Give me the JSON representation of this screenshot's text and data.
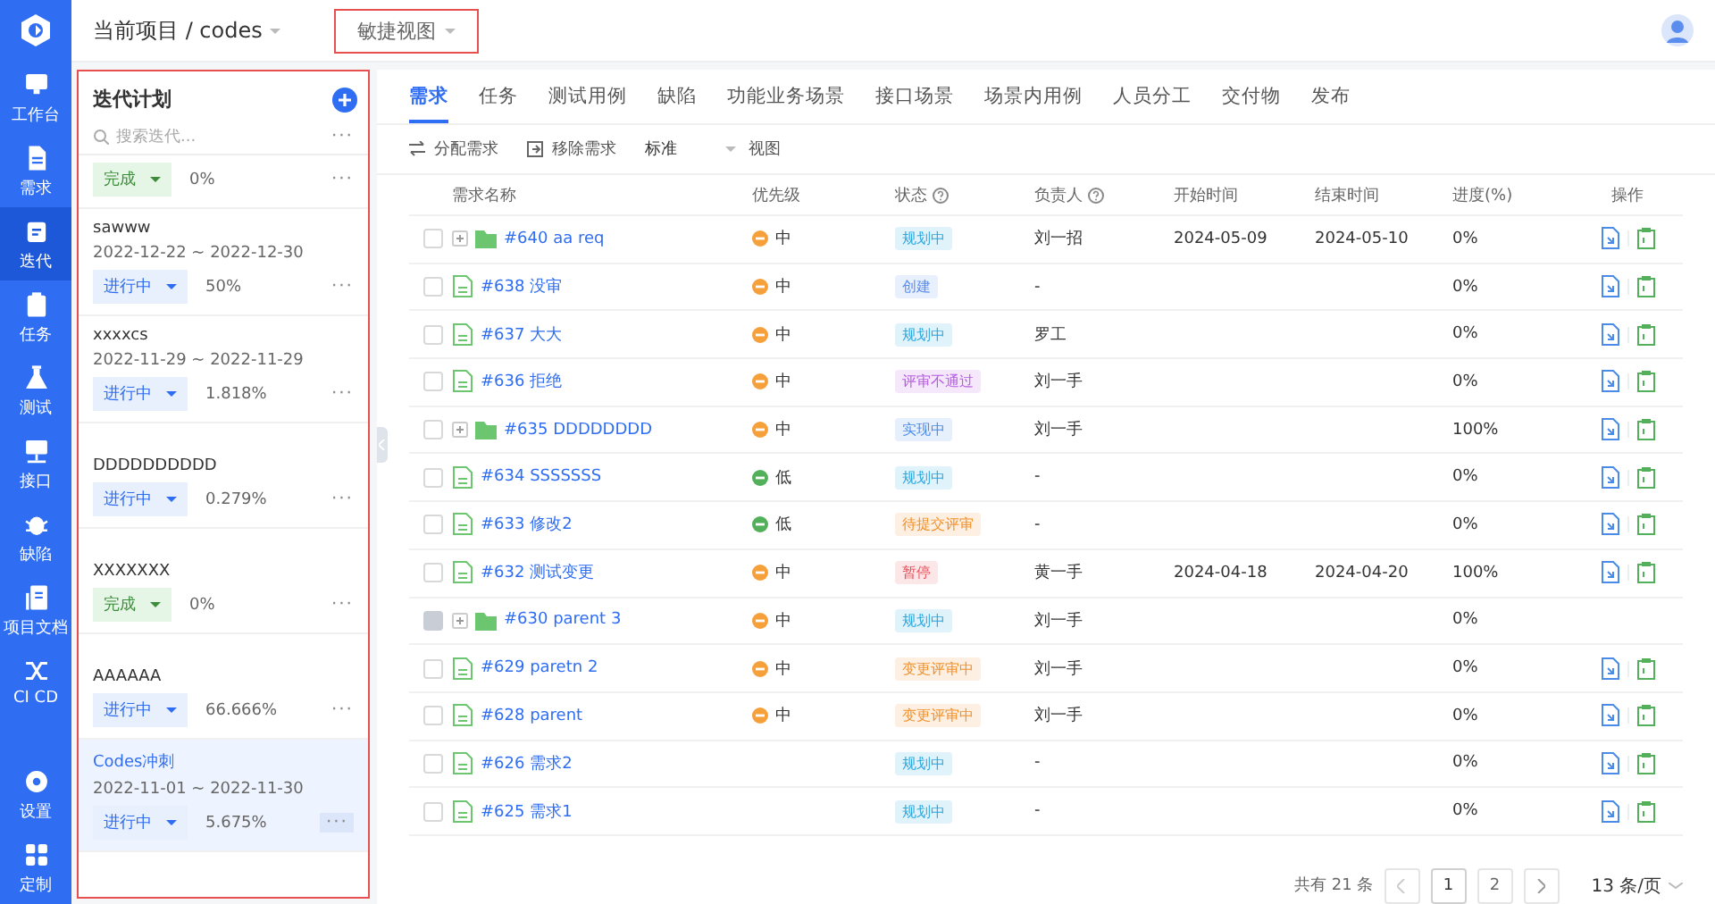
{
  "nav": {
    "items": [
      {
        "label": "工作台",
        "selected": false
      },
      {
        "label": "需求",
        "selected": false
      },
      {
        "label": "迭代",
        "selected": true
      },
      {
        "label": "任务",
        "selected": false
      },
      {
        "label": "测试",
        "selected": false
      },
      {
        "label": "接口",
        "selected": false
      },
      {
        "label": "缺陷",
        "selected": false
      },
      {
        "label": "项目文档",
        "selected": false
      },
      {
        "label": "CI CD",
        "selected": false
      }
    ],
    "bottom_items": [
      {
        "label": "设置",
        "selected": false
      },
      {
        "label": "定制",
        "selected": false
      }
    ]
  },
  "topbar": {
    "project_label": "当前项目 / codes",
    "view_label": "敏捷视图"
  },
  "iteration_panel": {
    "title": "迭代计划",
    "search": {
      "placeholder": "搜索迭代...",
      "more": "···"
    },
    "items": [
      {
        "status": "完成",
        "kind": "done",
        "progress": "0%",
        "more": "···",
        "selected": false
      },
      {
        "name": "sawww",
        "dates": "2022-12-22 ~ 2022-12-30",
        "status": "进行中",
        "kind": "active",
        "progress": "50%",
        "more": "···",
        "selected": false
      },
      {
        "name": "xxxxcs",
        "dates": "2022-11-29 ~ 2022-11-29",
        "status": "进行中",
        "kind": "active",
        "progress": "1.818%",
        "more": "···",
        "selected": false
      },
      {
        "name": "DDDDDDDDDD",
        "status": "进行中",
        "kind": "active",
        "progress": "0.279%",
        "more": "···",
        "selected": false
      },
      {
        "name": "XXXXXXX",
        "status": "完成",
        "kind": "done",
        "progress": "0%",
        "more": "···",
        "selected": false
      },
      {
        "name": "AAAAAA",
        "status": "进行中",
        "kind": "active",
        "progress": "66.666%",
        "more": "···",
        "selected": false
      },
      {
        "name": "Codes冲刺",
        "dates": "2022-11-01 ~ 2022-11-30",
        "status": "进行中",
        "kind": "active",
        "progress": "5.675%",
        "more": "···",
        "selected": true
      }
    ]
  },
  "tabs": [
    {
      "label": "需求",
      "selected": true
    },
    {
      "label": "任务",
      "selected": false
    },
    {
      "label": "测试用例",
      "selected": false
    },
    {
      "label": "缺陷",
      "selected": false
    },
    {
      "label": "功能业务场景",
      "selected": false
    },
    {
      "label": "接口场景",
      "selected": false
    },
    {
      "label": "场景内用例",
      "selected": false
    },
    {
      "label": "人员分工",
      "selected": false
    },
    {
      "label": "交付物",
      "selected": false
    },
    {
      "label": "发布",
      "selected": false
    }
  ],
  "toolbar": [
    {
      "label": "分配需求",
      "kind": "swap"
    },
    {
      "label": "移除需求",
      "kind": "remove"
    },
    {
      "label": "标准",
      "kind": "plain"
    },
    {
      "label": "视图",
      "kind": "dropdown"
    }
  ],
  "table": {
    "columns": [
      {
        "label": "需求名称",
        "help": false
      },
      {
        "label": "优先级",
        "help": false
      },
      {
        "label": "状态",
        "help": true
      },
      {
        "label": "负责人",
        "help": true
      },
      {
        "label": "开始时间",
        "help": false
      },
      {
        "label": "结束时间",
        "help": false
      },
      {
        "label": "进度(%)",
        "help": false
      },
      {
        "label": "操作",
        "help": false
      }
    ],
    "rows": [
      {
        "kind": "folder",
        "name": "#640 aa req",
        "priority": {
          "label": "中",
          "color": "#f5a03a"
        },
        "status": {
          "label": "规划中",
          "color": "#2ba6de"
        },
        "owner": "刘一招",
        "start": "2024-05-09",
        "end": "2024-05-10",
        "progress": "0%",
        "disabled": false,
        "actions": true
      },
      {
        "kind": "doc",
        "name": "#638 没审",
        "priority": {
          "label": "中",
          "color": "#f5a03a"
        },
        "status": {
          "label": "创建",
          "color": "#5b8def"
        },
        "owner": "-",
        "progress": "0%",
        "disabled": false,
        "actions": true
      },
      {
        "kind": "doc",
        "name": "#637 大大",
        "priority": {
          "label": "中",
          "color": "#f5a03a"
        },
        "status": {
          "label": "规划中",
          "color": "#2ba6de"
        },
        "owner": "罗工",
        "progress": "0%",
        "disabled": false,
        "actions": true
      },
      {
        "kind": "doc",
        "name": "#636 拒绝",
        "priority": {
          "label": "中",
          "color": "#f5a03a"
        },
        "status": {
          "label": "评审不通过",
          "color": "#b55be0"
        },
        "owner": "刘一手",
        "progress": "0%",
        "disabled": false,
        "actions": true
      },
      {
        "kind": "folder",
        "name": "#635 DDDDDDDD",
        "priority": {
          "label": "中",
          "color": "#f5a03a"
        },
        "status": {
          "label": "实现中",
          "color": "#4a8be8"
        },
        "owner": "刘一手",
        "progress": "100%",
        "disabled": false,
        "actions": true
      },
      {
        "kind": "doc",
        "name": "#634 SSSSSSS",
        "priority": {
          "label": "低",
          "color": "#52b05a"
        },
        "status": {
          "label": "规划中",
          "color": "#2ba6de"
        },
        "owner": "-",
        "progress": "0%",
        "disabled": false,
        "actions": true
      },
      {
        "kind": "doc",
        "name": "#633 修改2",
        "priority": {
          "label": "低",
          "color": "#52b05a"
        },
        "status": {
          "label": "待提交评审",
          "color": "#f0902a"
        },
        "owner": "-",
        "progress": "0%",
        "disabled": false,
        "actions": true
      },
      {
        "kind": "doc",
        "name": "#632 测试变更",
        "priority": {
          "label": "中",
          "color": "#f5a03a"
        },
        "status": {
          "label": "暂停",
          "color": "#e8505b"
        },
        "owner": "黄一手",
        "start": "2024-04-18",
        "end": "2024-04-20",
        "progress": "100%",
        "disabled": false,
        "actions": true
      },
      {
        "kind": "folder",
        "name": "#630 parent 3",
        "priority": {
          "label": "中",
          "color": "#f5a03a"
        },
        "status": {
          "label": "规划中",
          "color": "#2ba6de"
        },
        "owner": "刘一手",
        "progress": "0%",
        "disabled": true,
        "actions": false
      },
      {
        "kind": "doc",
        "name": "#629 paretn 2",
        "priority": {
          "label": "中",
          "color": "#f5a03a"
        },
        "status": {
          "label": "变更评审中",
          "color": "#f0902a"
        },
        "owner": "刘一手",
        "progress": "0%",
        "disabled": false,
        "actions": true
      },
      {
        "kind": "doc",
        "name": "#628 parent",
        "priority": {
          "label": "中",
          "color": "#f5a03a"
        },
        "status": {
          "label": "变更评审中",
          "color": "#f0902a"
        },
        "owner": "刘一手",
        "progress": "0%",
        "disabled": false,
        "actions": true
      },
      {
        "kind": "doc",
        "name": "#626 需求2",
        "status": {
          "label": "规划中",
          "color": "#2ba6de"
        },
        "owner": "-",
        "progress": "0%",
        "disabled": false,
        "actions": true
      },
      {
        "kind": "doc",
        "name": "#625 需求1",
        "status": {
          "label": "规划中",
          "color": "#2ba6de"
        },
        "owner": "-",
        "progress": "0%",
        "disabled": false,
        "actions": true
      }
    ]
  },
  "pagination": {
    "total": "共有 21 条",
    "pages": [
      {
        "label": "1",
        "selected": true
      },
      {
        "label": "2",
        "selected": false
      }
    ],
    "page_size": "13 条/页"
  }
}
